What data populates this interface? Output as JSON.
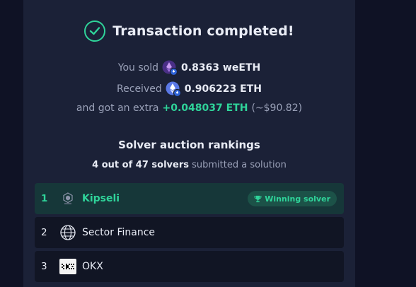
{
  "header": {
    "title": "Transaction completed!"
  },
  "summary": {
    "sold_label": "You sold",
    "sold_amount": "0.8363 weETH",
    "received_label": "Received",
    "received_amount": "0.906223 ETH",
    "extra_label": "and got an extra",
    "extra_amount": "+0.048037 ETH",
    "extra_usd": "(~$90.82)"
  },
  "rankings": {
    "title": "Solver auction rankings",
    "count_bold": "4 out of 47 solvers",
    "count_rest": "submitted a solution",
    "winner_badge": "Winning solver",
    "solvers": [
      {
        "rank": "1",
        "name": "Kipseli",
        "icon": "kipseli-logo"
      },
      {
        "rank": "2",
        "name": "Sector Finance",
        "icon": "globe-logo"
      },
      {
        "rank": "3",
        "name": "OKX",
        "icon": "okx-logo"
      }
    ]
  },
  "colors": {
    "accent": "#2fd49a",
    "panel": "#1b2137",
    "win_row": "#163739"
  }
}
